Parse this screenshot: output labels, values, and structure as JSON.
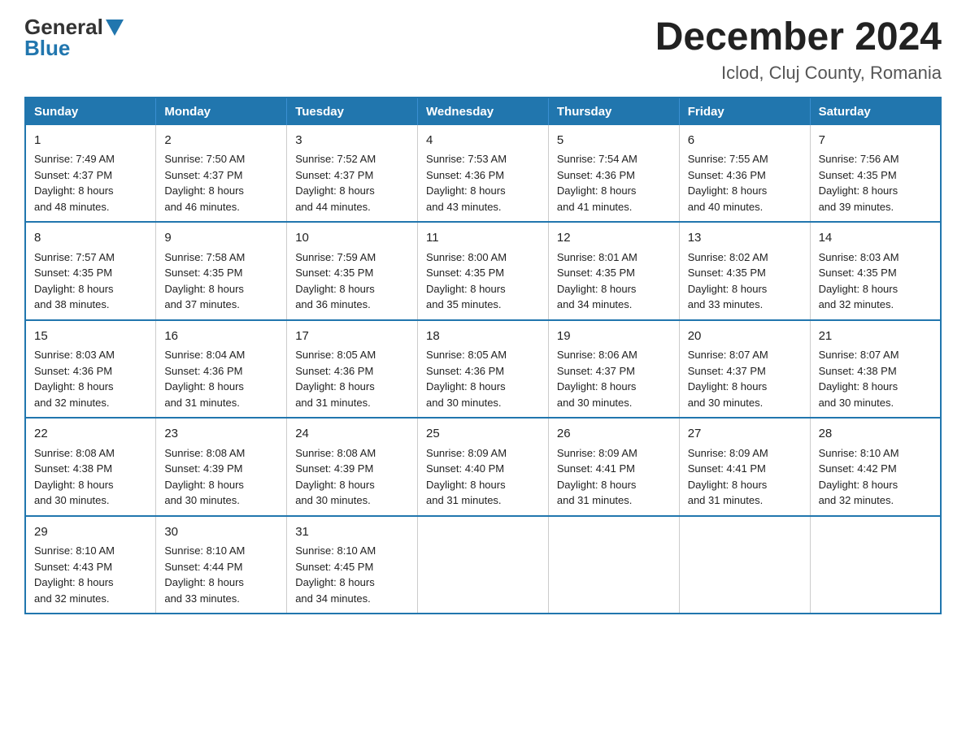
{
  "logo": {
    "general": "General",
    "blue": "Blue",
    "triangle": "▶"
  },
  "header": {
    "month": "December 2024",
    "location": "Iclod, Cluj County, Romania"
  },
  "days_of_week": [
    "Sunday",
    "Monday",
    "Tuesday",
    "Wednesday",
    "Thursday",
    "Friday",
    "Saturday"
  ],
  "weeks": [
    [
      {
        "num": "1",
        "sunrise": "7:49 AM",
        "sunset": "4:37 PM",
        "daylight": "8 hours and 48 minutes."
      },
      {
        "num": "2",
        "sunrise": "7:50 AM",
        "sunset": "4:37 PM",
        "daylight": "8 hours and 46 minutes."
      },
      {
        "num": "3",
        "sunrise": "7:52 AM",
        "sunset": "4:37 PM",
        "daylight": "8 hours and 44 minutes."
      },
      {
        "num": "4",
        "sunrise": "7:53 AM",
        "sunset": "4:36 PM",
        "daylight": "8 hours and 43 minutes."
      },
      {
        "num": "5",
        "sunrise": "7:54 AM",
        "sunset": "4:36 PM",
        "daylight": "8 hours and 41 minutes."
      },
      {
        "num": "6",
        "sunrise": "7:55 AM",
        "sunset": "4:36 PM",
        "daylight": "8 hours and 40 minutes."
      },
      {
        "num": "7",
        "sunrise": "7:56 AM",
        "sunset": "4:35 PM",
        "daylight": "8 hours and 39 minutes."
      }
    ],
    [
      {
        "num": "8",
        "sunrise": "7:57 AM",
        "sunset": "4:35 PM",
        "daylight": "8 hours and 38 minutes."
      },
      {
        "num": "9",
        "sunrise": "7:58 AM",
        "sunset": "4:35 PM",
        "daylight": "8 hours and 37 minutes."
      },
      {
        "num": "10",
        "sunrise": "7:59 AM",
        "sunset": "4:35 PM",
        "daylight": "8 hours and 36 minutes."
      },
      {
        "num": "11",
        "sunrise": "8:00 AM",
        "sunset": "4:35 PM",
        "daylight": "8 hours and 35 minutes."
      },
      {
        "num": "12",
        "sunrise": "8:01 AM",
        "sunset": "4:35 PM",
        "daylight": "8 hours and 34 minutes."
      },
      {
        "num": "13",
        "sunrise": "8:02 AM",
        "sunset": "4:35 PM",
        "daylight": "8 hours and 33 minutes."
      },
      {
        "num": "14",
        "sunrise": "8:03 AM",
        "sunset": "4:35 PM",
        "daylight": "8 hours and 32 minutes."
      }
    ],
    [
      {
        "num": "15",
        "sunrise": "8:03 AM",
        "sunset": "4:36 PM",
        "daylight": "8 hours and 32 minutes."
      },
      {
        "num": "16",
        "sunrise": "8:04 AM",
        "sunset": "4:36 PM",
        "daylight": "8 hours and 31 minutes."
      },
      {
        "num": "17",
        "sunrise": "8:05 AM",
        "sunset": "4:36 PM",
        "daylight": "8 hours and 31 minutes."
      },
      {
        "num": "18",
        "sunrise": "8:05 AM",
        "sunset": "4:36 PM",
        "daylight": "8 hours and 30 minutes."
      },
      {
        "num": "19",
        "sunrise": "8:06 AM",
        "sunset": "4:37 PM",
        "daylight": "8 hours and 30 minutes."
      },
      {
        "num": "20",
        "sunrise": "8:07 AM",
        "sunset": "4:37 PM",
        "daylight": "8 hours and 30 minutes."
      },
      {
        "num": "21",
        "sunrise": "8:07 AM",
        "sunset": "4:38 PM",
        "daylight": "8 hours and 30 minutes."
      }
    ],
    [
      {
        "num": "22",
        "sunrise": "8:08 AM",
        "sunset": "4:38 PM",
        "daylight": "8 hours and 30 minutes."
      },
      {
        "num": "23",
        "sunrise": "8:08 AM",
        "sunset": "4:39 PM",
        "daylight": "8 hours and 30 minutes."
      },
      {
        "num": "24",
        "sunrise": "8:08 AM",
        "sunset": "4:39 PM",
        "daylight": "8 hours and 30 minutes."
      },
      {
        "num": "25",
        "sunrise": "8:09 AM",
        "sunset": "4:40 PM",
        "daylight": "8 hours and 31 minutes."
      },
      {
        "num": "26",
        "sunrise": "8:09 AM",
        "sunset": "4:41 PM",
        "daylight": "8 hours and 31 minutes."
      },
      {
        "num": "27",
        "sunrise": "8:09 AM",
        "sunset": "4:41 PM",
        "daylight": "8 hours and 31 minutes."
      },
      {
        "num": "28",
        "sunrise": "8:10 AM",
        "sunset": "4:42 PM",
        "daylight": "8 hours and 32 minutes."
      }
    ],
    [
      {
        "num": "29",
        "sunrise": "8:10 AM",
        "sunset": "4:43 PM",
        "daylight": "8 hours and 32 minutes."
      },
      {
        "num": "30",
        "sunrise": "8:10 AM",
        "sunset": "4:44 PM",
        "daylight": "8 hours and 33 minutes."
      },
      {
        "num": "31",
        "sunrise": "8:10 AM",
        "sunset": "4:45 PM",
        "daylight": "8 hours and 34 minutes."
      },
      null,
      null,
      null,
      null
    ]
  ],
  "labels": {
    "sunrise": "Sunrise:",
    "sunset": "Sunset:",
    "daylight": "Daylight:"
  }
}
